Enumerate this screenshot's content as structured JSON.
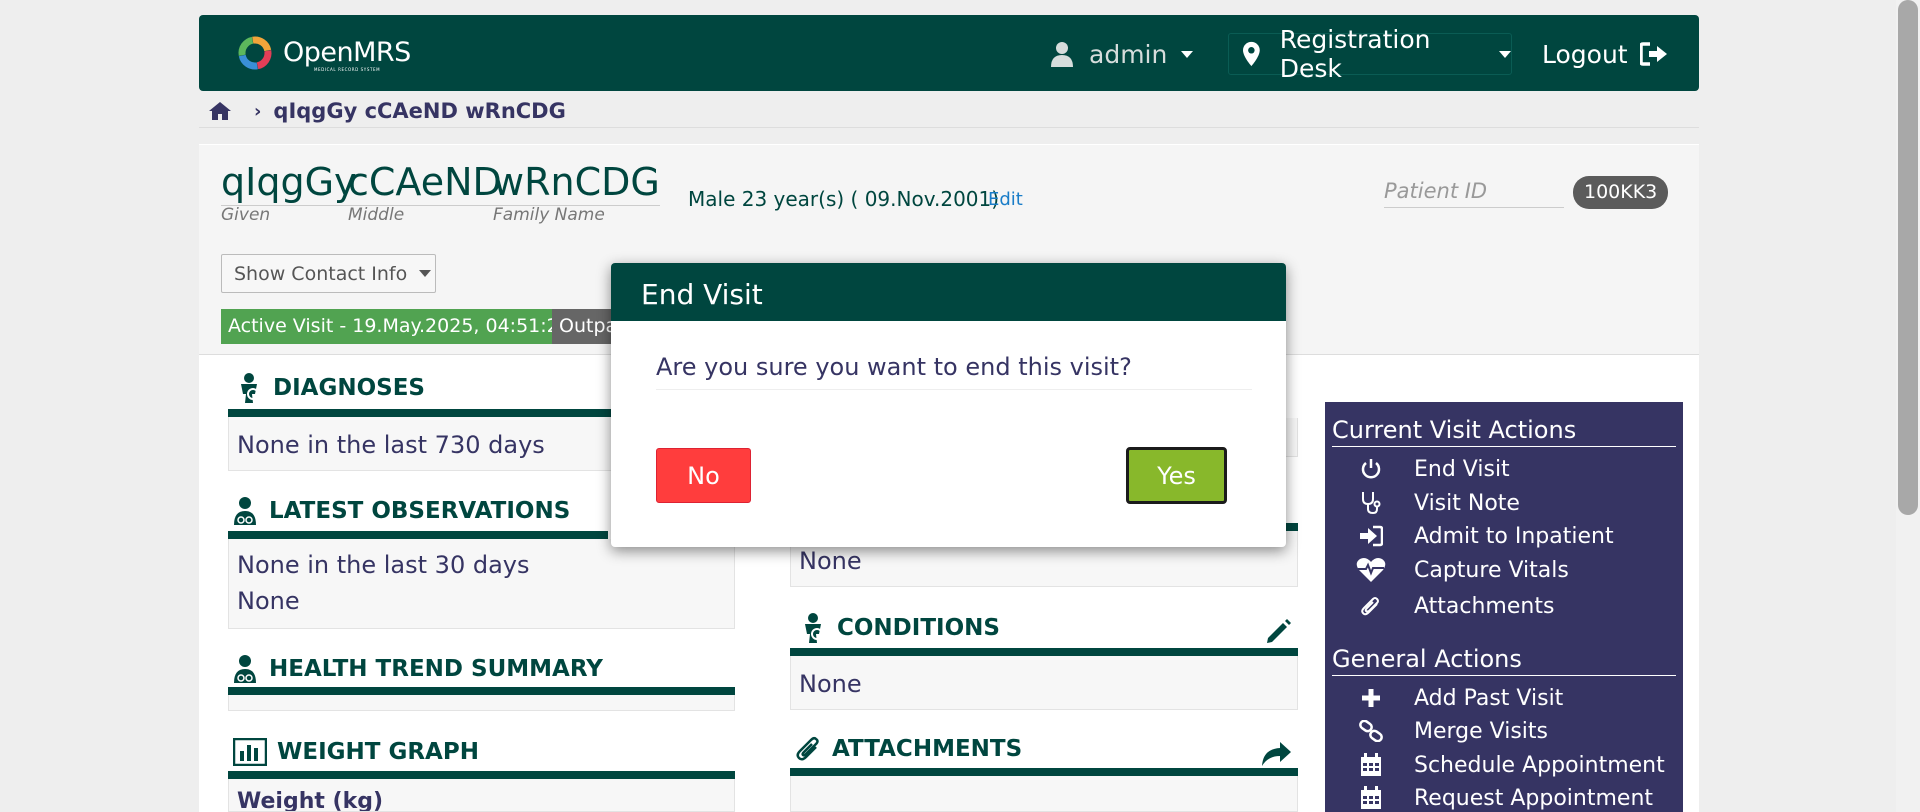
{
  "header": {
    "logo_text": "OpenMRS",
    "logo_sub": "MEDICAL RECORD SYSTEM",
    "user": "admin",
    "location": "Registration Desk",
    "logout": "Logout"
  },
  "breadcrumb": {
    "patient": "qIqgGy cCAeND wRnCDG"
  },
  "patient": {
    "given": "qIqgGy",
    "middle": "cCAeND",
    "family": "wRnCDG",
    "given_label": "Given",
    "middle_label": "Middle",
    "family_label": "Family Name",
    "demographics": "Male  23 year(s) ( 09.Nov.2001)",
    "edit": "Edit",
    "pid_label": "Patient ID",
    "pid": "100KK3",
    "contact_btn": "Show Contact Info",
    "active_visit": "Active Visit - 19.May.2025, 04:51:25",
    "visit_type": "Outpatient"
  },
  "sections": {
    "diagnoses": {
      "title": "DIAGNOSES",
      "text": "None in the last 730 days"
    },
    "observations": {
      "title": "LATEST OBSERVATIONS",
      "line1": "None in the last 30 days",
      "line2": "None"
    },
    "health_trend": {
      "title": "HEALTH TREND SUMMARY"
    },
    "weight": {
      "title": "WEIGHT GRAPH",
      "label": "Weight (kg)"
    },
    "mid_box": {
      "text": "None"
    },
    "conditions": {
      "title": "CONDITIONS",
      "text": "None"
    },
    "attachments": {
      "title": "ATTACHMENTS"
    }
  },
  "sidebar": {
    "current_head": "Current Visit Actions",
    "current_items": [
      {
        "label": "End Visit",
        "icon": "power-icon"
      },
      {
        "label": "Visit Note",
        "icon": "stethoscope-icon"
      },
      {
        "label": "Admit to Inpatient",
        "icon": "sign-in-icon"
      },
      {
        "label": "Capture Vitals",
        "icon": "heartbeat-icon"
      },
      {
        "label": "Attachments",
        "icon": "paperclip-icon"
      }
    ],
    "general_head": "General Actions",
    "general_items": [
      {
        "label": "Add Past Visit",
        "icon": "plus-icon"
      },
      {
        "label": "Merge Visits",
        "icon": "link-icon"
      },
      {
        "label": "Schedule Appointment",
        "icon": "calendar-icon"
      },
      {
        "label": "Request Appointment",
        "icon": "calendar-icon"
      }
    ]
  },
  "modal": {
    "title": "End Visit",
    "question": "Are you sure you want to end this visit?",
    "no": "No",
    "yes": "Yes"
  },
  "colors": {
    "brand": "#00463f",
    "sidebar": "#363463",
    "yes": "#88b82b",
    "no": "#ff3d3d",
    "visit": "#51a351"
  }
}
